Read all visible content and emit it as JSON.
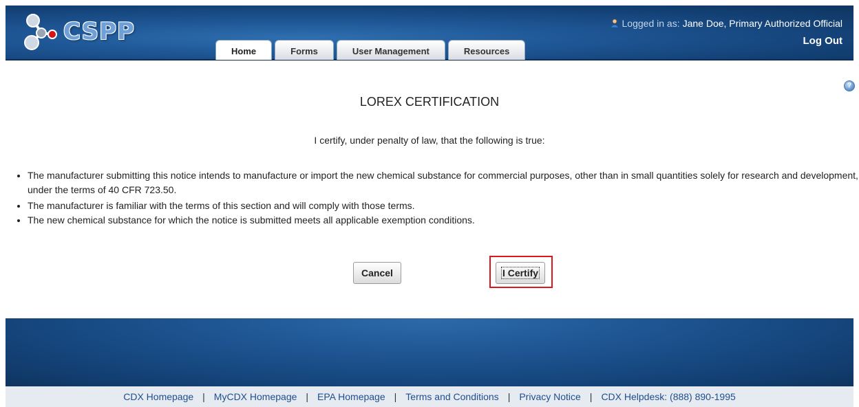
{
  "app": {
    "logo_text": "CSPP"
  },
  "header": {
    "logged_in_label": "Logged in as:",
    "user_name": "Jane Doe, Primary Authorized Official",
    "logout_label": "Log Out"
  },
  "tabs": [
    {
      "label": "Home",
      "active": true
    },
    {
      "label": "Forms",
      "active": false
    },
    {
      "label": "User Management",
      "active": false
    },
    {
      "label": "Resources",
      "active": false
    }
  ],
  "main": {
    "title": "LOREX CERTIFICATION",
    "certify_statement": "I certify, under penalty of law, that the following is true:",
    "bullets": [
      "The manufacturer submitting this notice intends to manufacture or import the new chemical substance for commercial purposes, other than in small quantities solely for research and development, under the terms of 40 CFR 723.50.",
      "The manufacturer is familiar with the terms of this section and will comply with those terms.",
      "The new chemical substance for which the notice is submitted meets all applicable exemption conditions."
    ],
    "cancel_label": "Cancel",
    "certify_label": "I Certify",
    "highlight_color": "#e0151b"
  },
  "footer": {
    "links": [
      "CDX Homepage",
      "MyCDX Homepage",
      "EPA Homepage",
      "Terms and Conditions",
      "Privacy Notice",
      "CDX Helpdesk: (888) 890-1995"
    ],
    "separator": "|"
  },
  "icons": {
    "logo": "molecule-icon",
    "user": "user-icon",
    "help": "help-icon"
  }
}
